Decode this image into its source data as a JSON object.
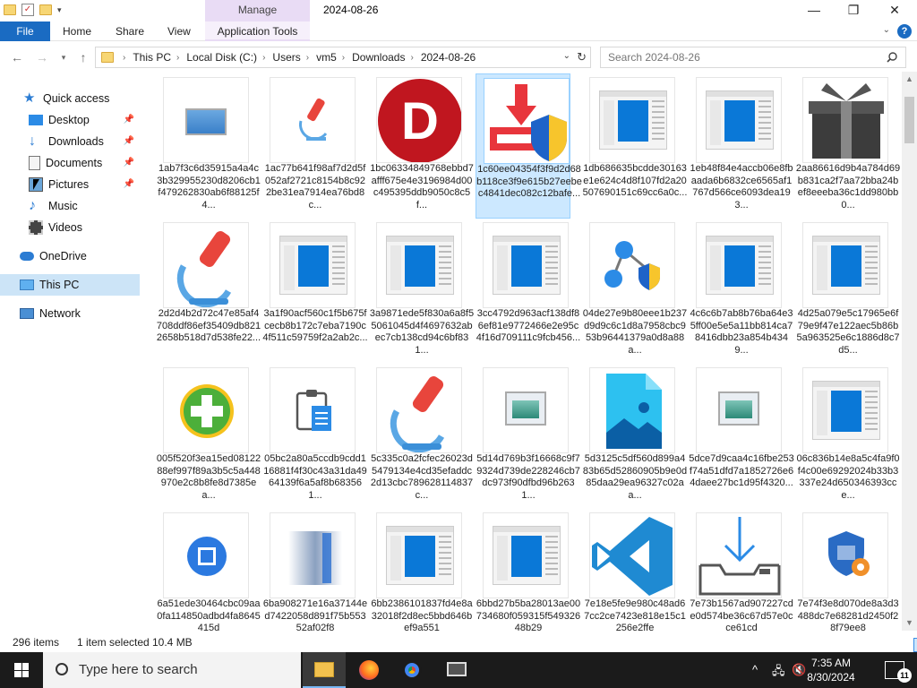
{
  "titlebar": {
    "manage_label": "Manage",
    "title": "2024-08-26",
    "minimize": "—",
    "maximize": "❐",
    "close": "✕"
  },
  "ribbon": {
    "tabs": [
      "File",
      "Home",
      "Share",
      "View",
      "Application Tools"
    ]
  },
  "address": {
    "crumbs": [
      "This PC",
      "Local Disk (C:)",
      "Users",
      "vm5",
      "Downloads",
      "2024-08-26"
    ]
  },
  "search": {
    "placeholder": "Search 2024-08-26"
  },
  "sidebar": {
    "items": [
      {
        "label": "Quick access"
      },
      {
        "label": "Desktop"
      },
      {
        "label": "Downloads"
      },
      {
        "label": "Documents"
      },
      {
        "label": "Pictures"
      },
      {
        "label": "Music"
      },
      {
        "label": "Videos"
      },
      {
        "label": "OneDrive"
      },
      {
        "label": "This PC"
      },
      {
        "label": "Network"
      }
    ]
  },
  "files": [
    {
      "name": "1ab7f3c6d35915a4a4c3b329955230d8206cb1f479262830ab6f88125f4...",
      "kind": "image"
    },
    {
      "name": "1ac77b641f98af7d2d5f052af2721c8154b8c922be31ea7914ea76bd8c...",
      "kind": "microscope-small"
    },
    {
      "name": "1bc06334849768ebbd7afff675e4e3196984d00c495395ddb9050c8c5f...",
      "kind": "dlogo"
    },
    {
      "name": "1c60ee04354f3f9d2d68b118ce3f9e615b27eebec4841dec082c12bafe...",
      "kind": "installer"
    },
    {
      "name": "1db686635bcdde30163e1e624c4d8f107fd2a20507690151c69cc6a0c...",
      "kind": "doc"
    },
    {
      "name": "1eb48f84e4accb06e8fbaada6b6832ce6565af1767d566ce6093dea193...",
      "kind": "doc"
    },
    {
      "name": "2aa86616d9b4a784d69b831ca2f7aa72bba24bef8eeeba36c1dd980bb0...",
      "kind": "gift"
    },
    {
      "name": "2d2d4b2d72c47e85af4708ddf86ef35409db8212658b518d7d538fe22...",
      "kind": "microscope"
    },
    {
      "name": "3a1f90acf560c1f5b675fcecb8b172c7eba7190c4f511c59759f2a2ab2c...",
      "kind": "doc"
    },
    {
      "name": "3a9871ede5f830a6a8f55061045d4f4697632abec7cb138cd94c6bf831...",
      "kind": "doc"
    },
    {
      "name": "3cc4792d963acf138df86ef81e9772466e2e95c4f16d709111c9fcb456...",
      "kind": "doc"
    },
    {
      "name": "04de27e9b80eee1b237d9d9c6c1d8a7958cbc953b96441379a0d8a88a...",
      "kind": "network"
    },
    {
      "name": "4c6c6b7ab8b76ba64e35ff00e5e5a11bb814ca78416dbb23a854b4349...",
      "kind": "doc"
    },
    {
      "name": "4d25a079e5c17965e6f79e9f47e122aec5b86b5a963525e6c1886d8c7d5...",
      "kind": "doc"
    },
    {
      "name": "005f520f3ea15ed0812288ef997f89a3b5c5a448970e2c8b8fe8d7385ea...",
      "kind": "plus"
    },
    {
      "name": "05bc2a80a5ccdb9cdd116881f4f30c43a31da4964139f6a5af8b683561...",
      "kind": "clipboard"
    },
    {
      "name": "5c335c0a2fcfec26023d5479134e4cd35efaddc2d13cbc789628114837c...",
      "kind": "microscope"
    },
    {
      "name": "5d14d769b3f16668c9f79324d739de228246cb7dc973f90dfbd96b2631...",
      "kind": "image2"
    },
    {
      "name": "5d3125c5df560d899a483b65d52860905b9e0d85daa29ea96327c02aa...",
      "kind": "photo"
    },
    {
      "name": "5dce7d9caa4c16fbe253f74a51dfd7a1852726e64daee27bc1d95f4320...",
      "kind": "image2"
    },
    {
      "name": "06c836b14e8a5c4fa9f0f4c00e69292024b33b3337e24d650346393cce...",
      "kind": "doc"
    },
    {
      "name": "6a51ede30464cbc09aa0fa114850adbd4fa8645415d",
      "kind": "video"
    },
    {
      "name": "6ba908271e16a37144ed7422058d891f75b55352af02f8",
      "kind": "blur"
    },
    {
      "name": "6bb2386101837fd4e8a32018f2d8ec5bbd646bef9a551",
      "kind": "doc"
    },
    {
      "name": "6bbd27b5ba28013ae00734680f059315f54932648b29",
      "kind": "doc"
    },
    {
      "name": "7e18e5fe9e980c48ad67cc2ce7423e818e15c1256e2ffe",
      "kind": "vscode"
    },
    {
      "name": "7e73b1567ad907227cde0d574be36c67d57e0cce61cd",
      "kind": "download"
    },
    {
      "name": "7e74f3e8d070de8a3d3488dc7e68281d2450f28f79ee8",
      "kind": "shield"
    }
  ],
  "status": {
    "count": "296 items",
    "selected": "1 item selected",
    "size": "10.4 MB"
  },
  "taskbar": {
    "search_placeholder": "Type here to search",
    "time": "7:35 AM",
    "date": "8/30/2024",
    "notification_count": "11"
  }
}
